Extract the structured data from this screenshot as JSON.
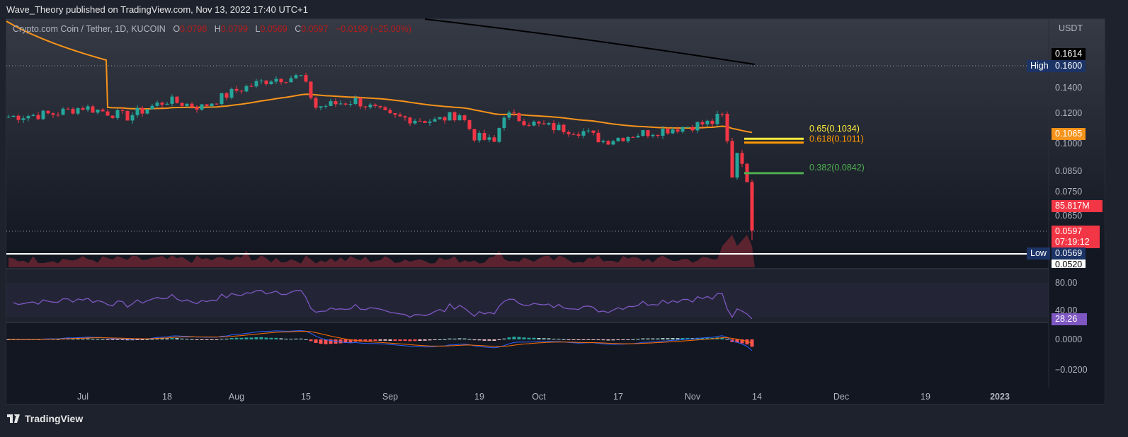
{
  "publisher_line": "Wave_Theory published on TradingView.com, Nov 13, 2022 17:40 UTC+1",
  "legend": {
    "symbol": "Crypto.com Coin / Tether, 1D, KUCOIN",
    "o_label": "O",
    "o": "0.0798",
    "h_label": "H",
    "h": "0.0799",
    "l_label": "L",
    "l": "0.0569",
    "c_label": "C",
    "c": "0.0597",
    "change": "−0.0199 (−25.00%)"
  },
  "currency": "USDT",
  "price_ticks": [
    "0.1400",
    "0.1200",
    "0.1000",
    "0.0850",
    "0.0750",
    "0.0650"
  ],
  "price_tick_values": [
    0.14,
    0.12,
    0.1,
    0.085,
    0.075,
    0.065
  ],
  "labels": {
    "ma200": "0.1614",
    "high_tag": "High",
    "high": "0.1600",
    "ma50": "0.1065",
    "volume": "85.817M",
    "last": "0.0597",
    "countdown": "07:19:12",
    "low_tag": "Low",
    "low": "0.0569",
    "min": "0.0520"
  },
  "fib": [
    {
      "label": "0.65(0.1034)",
      "value": 0.1034,
      "color": "#ffeb3b"
    },
    {
      "label": "0.618(0.1011)",
      "value": 0.1011,
      "color": "#ff9800"
    },
    {
      "label": "0.382(0.0842)",
      "value": 0.0842,
      "color": "#4caf50"
    }
  ],
  "rsi": {
    "ticks": [
      "80.00",
      "40.00"
    ],
    "value": "28.26",
    "color": "#7e57c2"
  },
  "macd": {
    "ticks": [
      "0.0000",
      "−0.0200"
    ]
  },
  "time_ticks": [
    "Jul",
    "18",
    "Aug",
    "15",
    "Sep",
    "19",
    "Oct",
    "17",
    "Nov",
    "14",
    "Dec",
    "19",
    "2023"
  ],
  "time_tick_days": [
    15,
    32,
    46,
    60,
    77,
    95,
    107,
    123,
    138,
    151,
    168,
    185,
    200
  ],
  "colors": {
    "up": "#26a69a",
    "down": "#f23645",
    "ma50": "#f7931a",
    "ma200": "#000000"
  },
  "footer": "TradingView",
  "chart_data": {
    "type": "candlestick",
    "start": "2022-06-16",
    "end": "2022-11-13",
    "keyframes": [
      [
        0,
        0.118
      ],
      [
        9,
        0.12
      ],
      [
        15,
        0.125
      ],
      [
        24,
        0.118
      ],
      [
        32,
        0.13
      ],
      [
        39,
        0.125
      ],
      [
        46,
        0.138
      ],
      [
        53,
        0.148
      ],
      [
        59,
        0.15
      ],
      [
        62,
        0.125
      ],
      [
        70,
        0.13
      ],
      [
        77,
        0.118
      ],
      [
        86,
        0.115
      ],
      [
        91,
        0.12
      ],
      [
        94,
        0.105
      ],
      [
        98,
        0.101
      ],
      [
        100,
        0.12
      ],
      [
        107,
        0.112
      ],
      [
        116,
        0.108
      ],
      [
        120,
        0.102
      ],
      [
        126,
        0.106
      ],
      [
        134,
        0.11
      ],
      [
        142,
        0.114
      ],
      [
        144,
        0.12
      ],
      [
        145,
        0.102
      ],
      [
        146,
        0.082
      ],
      [
        147,
        0.095
      ],
      [
        148,
        0.089
      ],
      [
        149,
        0.0798
      ],
      [
        150,
        0.0597
      ]
    ]
  }
}
